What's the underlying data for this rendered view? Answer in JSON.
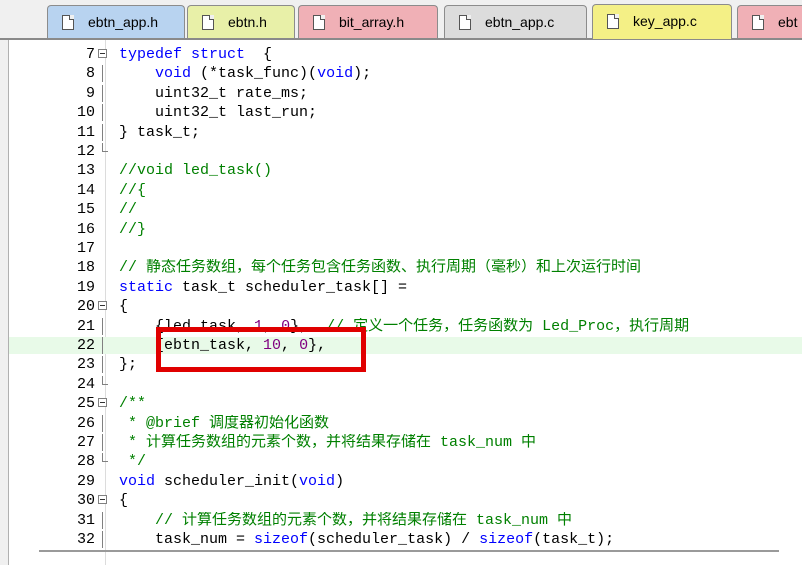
{
  "tabs": [
    {
      "label": "ebtn_app.h",
      "color": "#b8d3f0",
      "active": false
    },
    {
      "label": "ebtn.h",
      "color": "#e8f0a8",
      "active": false
    },
    {
      "label": "bit_array.h",
      "color": "#f0b0b6",
      "active": false
    },
    {
      "label": "ebtn_app.c",
      "color": "#dcdcdc",
      "active": false
    },
    {
      "label": "key_app.c",
      "color": "#f4f086",
      "active": true
    },
    {
      "label": "ebt",
      "color": "#f0b0b6",
      "active": false
    }
  ],
  "editor": {
    "highlight_line": 22,
    "lines": [
      {
        "n": "7",
        "fold": "open",
        "seg": [
          [
            "kw",
            "typedef struct"
          ],
          [
            "",
            "  {"
          ]
        ]
      },
      {
        "n": "8",
        "fold": "v",
        "seg": [
          [
            "",
            "    "
          ],
          [
            "kw",
            "void"
          ],
          [
            "",
            " (*task_func)("
          ],
          [
            "kw",
            "void"
          ],
          [
            "",
            ");"
          ]
        ]
      },
      {
        "n": "9",
        "fold": "v",
        "seg": [
          [
            "",
            "    uint32_t rate_ms;"
          ]
        ]
      },
      {
        "n": "10",
        "fold": "v",
        "seg": [
          [
            "",
            "    uint32_t last_run;"
          ]
        ]
      },
      {
        "n": "11",
        "fold": "v",
        "seg": [
          [
            "",
            "} task_t;"
          ]
        ]
      },
      {
        "n": "12",
        "fold": "end",
        "seg": []
      },
      {
        "n": "13",
        "fold": "",
        "seg": [
          [
            "cm",
            "//void led_task()"
          ]
        ]
      },
      {
        "n": "14",
        "fold": "",
        "seg": [
          [
            "cm",
            "//{"
          ]
        ]
      },
      {
        "n": "15",
        "fold": "",
        "seg": [
          [
            "cm",
            "//"
          ]
        ]
      },
      {
        "n": "16",
        "fold": "",
        "seg": [
          [
            "cm",
            "//}"
          ]
        ]
      },
      {
        "n": "17",
        "fold": "",
        "seg": []
      },
      {
        "n": "18",
        "fold": "",
        "seg": [
          [
            "cm",
            "// 静态任务数组，每个任务包含任务函数、执行周期（毫秒）和上次运行时间"
          ]
        ]
      },
      {
        "n": "19",
        "fold": "",
        "seg": [
          [
            "kw",
            "static"
          ],
          [
            "",
            " task_t scheduler_task[] ="
          ]
        ]
      },
      {
        "n": "20",
        "fold": "open",
        "seg": [
          [
            "",
            "{"
          ]
        ]
      },
      {
        "n": "21",
        "fold": "v",
        "seg": [
          [
            "",
            "    {led_task, "
          ],
          [
            "num",
            "1"
          ],
          [
            "",
            ", "
          ],
          [
            "num",
            "0"
          ],
          [
            "",
            "},  "
          ],
          [
            "cm",
            "// 定义一个任务，任务函数为 Led_Proc，执行周期"
          ]
        ]
      },
      {
        "n": "22",
        "fold": "v",
        "seg": [
          [
            "",
            "    {ebtn_task, "
          ],
          [
            "num",
            "10"
          ],
          [
            "",
            ", "
          ],
          [
            "num",
            "0"
          ],
          [
            "",
            "},"
          ]
        ]
      },
      {
        "n": "23",
        "fold": "v",
        "seg": [
          [
            "",
            "};"
          ]
        ]
      },
      {
        "n": "24",
        "fold": "end",
        "seg": []
      },
      {
        "n": "25",
        "fold": "open",
        "seg": [
          [
            "cm",
            "/**"
          ]
        ]
      },
      {
        "n": "26",
        "fold": "v",
        "seg": [
          [
            "cm",
            " * @brief 调度器初始化函数"
          ]
        ]
      },
      {
        "n": "27",
        "fold": "v",
        "seg": [
          [
            "cm",
            " * 计算任务数组的元素个数，并将结果存储在 task_num 中"
          ]
        ]
      },
      {
        "n": "28",
        "fold": "end",
        "seg": [
          [
            "cm",
            " */"
          ]
        ]
      },
      {
        "n": "29",
        "fold": "",
        "seg": [
          [
            "kw",
            "void"
          ],
          [
            "",
            " scheduler_init("
          ],
          [
            "kw",
            "void"
          ],
          [
            "",
            ")"
          ]
        ]
      },
      {
        "n": "30",
        "fold": "open",
        "seg": [
          [
            "",
            "{"
          ]
        ]
      },
      {
        "n": "31",
        "fold": "v",
        "seg": [
          [
            "",
            "    "
          ],
          [
            "cm",
            "// 计算任务数组的元素个数，并将结果存储在 task_num 中"
          ]
        ]
      },
      {
        "n": "32",
        "fold": "v",
        "seg": [
          [
            "",
            "    task_num = "
          ],
          [
            "kw",
            "sizeof"
          ],
          [
            "",
            "(scheduler_task) / "
          ],
          [
            "kw",
            "sizeof"
          ],
          [
            "",
            "(task_t);"
          ]
        ]
      }
    ]
  },
  "colors": {
    "keyword": "#0000ff",
    "comment": "#008000",
    "number": "#800080",
    "highlight": "#e8fae8",
    "annotation": "#e00000"
  }
}
